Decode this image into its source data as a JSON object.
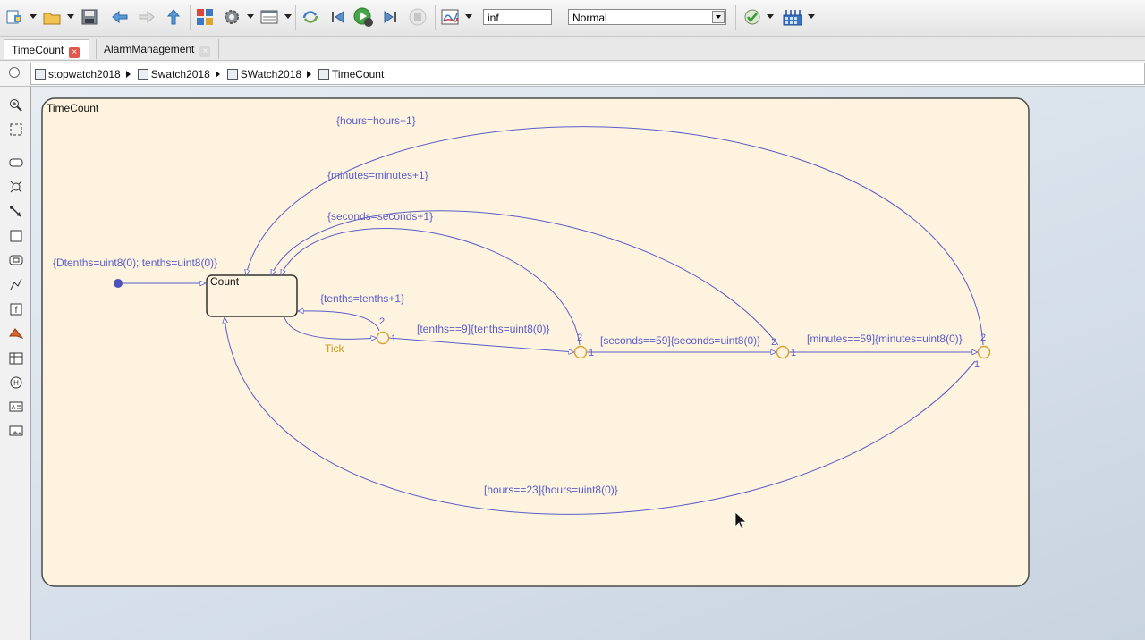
{
  "toolbar": {
    "stop_time": "inf",
    "sim_mode": "Normal"
  },
  "tabs": [
    {
      "label": "TimeCount"
    },
    {
      "label": "AlarmManagement"
    }
  ],
  "breadcrumb": [
    {
      "label": "stopwatch2018"
    },
    {
      "label": "Swatch2018"
    },
    {
      "label": "SWatch2018"
    },
    {
      "label": "TimeCount"
    }
  ],
  "chart": {
    "outer_state": "TimeCount",
    "inner_state": "Count",
    "default_action": "{Dtenths=uint8(0); tenths=uint8(0)}",
    "event_label": "Tick",
    "transitions": {
      "tenths_inc": "{tenths=tenths+1}",
      "seconds_inc": "{seconds=seconds+1}",
      "minutes_inc": "{minutes=minutes+1}",
      "hours_inc": "{hours=hours+1}",
      "tenths_cond": "[tenths==9]{tenths=uint8(0)}",
      "seconds_cond": "[seconds==59]{seconds=uint8(0)}",
      "minutes_cond": "[minutes==59]{minutes=uint8(0)}",
      "hours_cond": "[hours==23]{hours=uint8(0)}"
    },
    "junction_orders": {
      "j1_top": "2",
      "j1_right": "1",
      "j2_top": "2",
      "j2_right": "1",
      "j3_top": "2",
      "j3_right": "1",
      "j4_top": "2",
      "j4_bottom": "1"
    }
  },
  "colors": {
    "transition": "#5a5ec8",
    "label_text": "#5a5ec8",
    "number_literal": "#c62fc0",
    "state_fill": "#fdf3df",
    "junction": "#d9a237",
    "event": "#c8961b"
  }
}
